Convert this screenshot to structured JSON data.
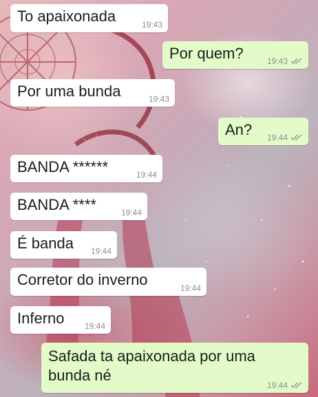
{
  "messages": [
    {
      "direction": "in",
      "text": "To apaixonada",
      "time": "19:43"
    },
    {
      "direction": "out",
      "text": "Por quem?",
      "time": "19:43",
      "status_icon": "double-check-icon"
    },
    {
      "direction": "in",
      "text": "Por uma bunda",
      "time": "19:43"
    },
    {
      "direction": "out",
      "text": "An?",
      "time": "19:44",
      "status_icon": "double-check-icon"
    },
    {
      "direction": "in",
      "text": "BANDA ******",
      "time": "19:44"
    },
    {
      "direction": "in",
      "text": "BANDA ****",
      "time": "19:44"
    },
    {
      "direction": "in",
      "text": "É banda",
      "time": "19:44"
    },
    {
      "direction": "in",
      "text": "Corretor do inverno",
      "time": "19:44"
    },
    {
      "direction": "in",
      "text": "Inferno",
      "time": "19:44"
    },
    {
      "direction": "out",
      "text": "Safada ta apaixonada por uma\nbunda né",
      "time": "19:44",
      "status_icon": "double-check-icon"
    }
  ],
  "colors": {
    "incoming_bubble": "#ffffff",
    "outgoing_bubble": "#e2fbc8",
    "timestamp": "#8f8f8f",
    "message_text": "#1b1b1b"
  }
}
